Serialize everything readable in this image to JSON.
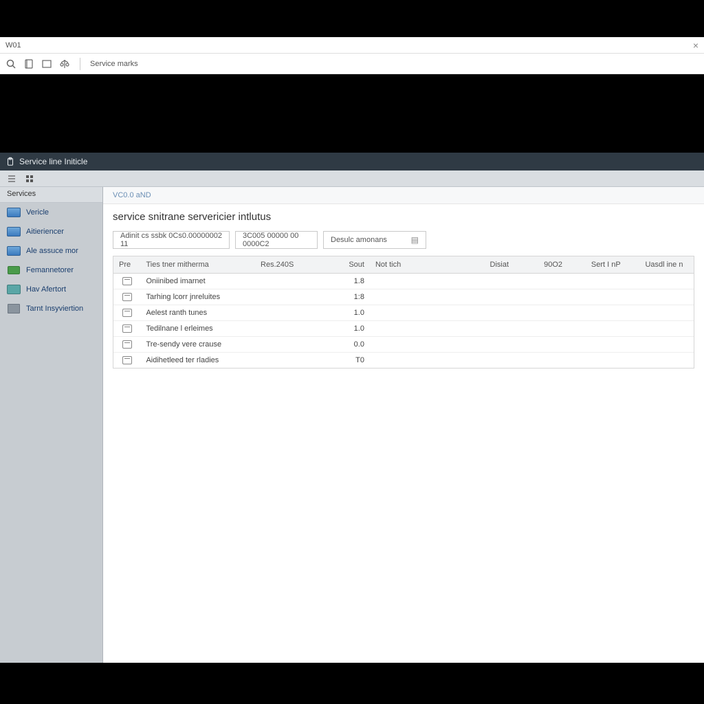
{
  "titlebar": {
    "text": "W01"
  },
  "toolbar": {
    "label": "Service marks"
  },
  "section_header": {
    "title": "Service line Initicle"
  },
  "sidebar": {
    "title": "Services",
    "items": [
      {
        "label": "Vericle"
      },
      {
        "label": "Aitieriencer"
      },
      {
        "label": "Ale assuce mor"
      },
      {
        "label": "Femannetorer"
      },
      {
        "label": "Hav Afertort"
      },
      {
        "label": "Tarnt Insyviertion"
      }
    ]
  },
  "main": {
    "breadcrumb": "VC0.0 aND",
    "title": "service snitrane servericier intlutus",
    "filters": {
      "f1": "Adinit cs ssbk 0Cs0.00000002 11",
      "f2": "3C005 00000 00 0000C2",
      "f3": "Desulc amonans"
    },
    "columns": {
      "c0": "Pre",
      "c1": "Ties tner mitherma",
      "c2": "Res.240S",
      "c3": "Sout",
      "c4": "Not tich",
      "c5": "Disiat",
      "c6": "90O2",
      "c7": "Sert I nP",
      "c8": "Uasdl ine n"
    },
    "rows": [
      {
        "name": "Oniinibed imarnet",
        "val": "1.8"
      },
      {
        "name": "Tarhing lcorr jnreluites",
        "val": "1:8"
      },
      {
        "name": "Aelest ranth tunes",
        "val": "1.0"
      },
      {
        "name": "Tedilnane l erleimes",
        "val": "1.0"
      },
      {
        "name": "Tre-sendy vere crause",
        "val": "0.0"
      },
      {
        "name": "Aidihetleed ter rladies",
        "val": "T0"
      }
    ]
  }
}
